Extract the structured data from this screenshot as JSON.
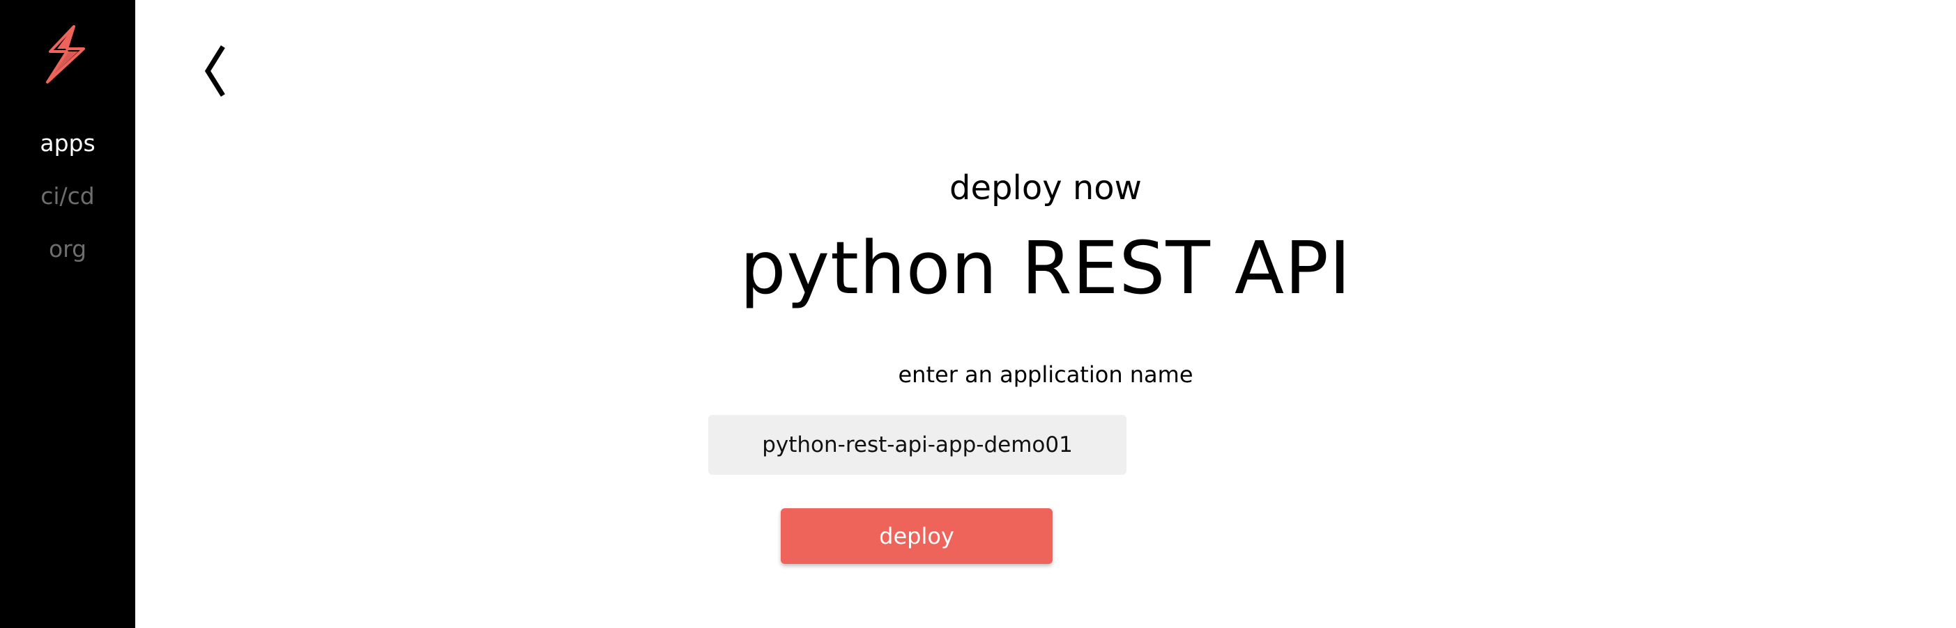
{
  "sidebar": {
    "logo_icon": "lightning-bolt-icon",
    "items": [
      {
        "label": "apps",
        "active": true
      },
      {
        "label": "ci/cd",
        "active": false
      },
      {
        "label": "org",
        "active": false
      }
    ]
  },
  "header": {
    "back_icon": "chevron-left-icon"
  },
  "main": {
    "subtitle": "deploy now",
    "title": "python REST API",
    "field_label": "enter an application name",
    "app_name_value": "python-rest-api-app-demo01",
    "deploy_label": "deploy"
  },
  "colors": {
    "sidebar_bg": "#000000",
    "accent": "#ee635a",
    "input_bg": "#efefef",
    "nav_active": "#ffffff",
    "nav_inactive": "#6e6e6e"
  }
}
